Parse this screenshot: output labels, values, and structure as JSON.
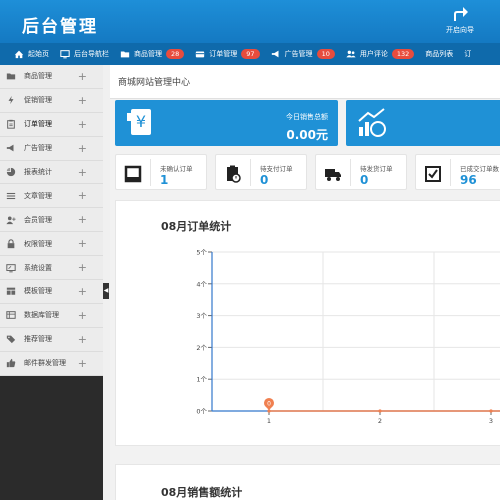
{
  "header": {
    "logo": "后台管理",
    "guide_label": "开启向导"
  },
  "nav": [
    {
      "label": "起始页",
      "icon": "home-icon",
      "badge": null
    },
    {
      "label": "后台导航栏",
      "icon": "monitor-icon",
      "badge": null
    },
    {
      "label": "商品管理",
      "icon": "folder-icon",
      "badge": "28"
    },
    {
      "label": "订单管理",
      "icon": "credit-card-icon",
      "badge": "97"
    },
    {
      "label": "广告管理",
      "icon": "megaphone-icon",
      "badge": "10"
    },
    {
      "label": "用户评论",
      "icon": "users-icon",
      "badge": "132"
    },
    {
      "label": "商品列表",
      "icon": null,
      "badge": null
    },
    {
      "label": "订",
      "icon": null,
      "badge": null
    }
  ],
  "sidebar": {
    "items": [
      {
        "label": "商品管理",
        "icon": "folder-icon"
      },
      {
        "label": "促销管理",
        "icon": "bolt-icon"
      },
      {
        "label": "订单管理",
        "icon": "clipboard-icon",
        "active": true
      },
      {
        "label": "广告管理",
        "icon": "megaphone-icon"
      },
      {
        "label": "报表统计",
        "icon": "pie-chart-icon"
      },
      {
        "label": "文章管理",
        "icon": "list-icon"
      },
      {
        "label": "会员管理",
        "icon": "user-plus-icon"
      },
      {
        "label": "权限管理",
        "icon": "lock-icon"
      },
      {
        "label": "系统设置",
        "icon": "desktop-icon"
      },
      {
        "label": "模板管理",
        "icon": "grid-icon"
      },
      {
        "label": "数据库管理",
        "icon": "database-icon"
      },
      {
        "label": "推荐管理",
        "icon": "tag-icon"
      },
      {
        "label": "邮件群发管理",
        "icon": "thumbs-up-icon"
      }
    ],
    "toggle": "◀"
  },
  "main": {
    "title": "商城网站管理中心",
    "sales_today_label": "今日销售总额",
    "sales_today_value": "0.00元",
    "order_stats": [
      {
        "label": "未确认订单",
        "value": "1",
        "icon": "square-icon"
      },
      {
        "label": "待支付订单",
        "value": "0",
        "icon": "clipboard-clock-icon"
      },
      {
        "label": "待发货订单",
        "value": "0",
        "icon": "truck-icon"
      },
      {
        "label": "已成交订单数",
        "value": "96",
        "icon": "check-list-icon"
      }
    ],
    "order_chart_title": "08月订单统计",
    "sales_chart_title": "08月销售额统计"
  },
  "colors": {
    "primary": "#1f91d6",
    "header": "#1479c2",
    "nav": "#0f6aab",
    "badge": "#e84c3d",
    "series": "#f08050"
  },
  "chart_data": {
    "type": "line",
    "title": "08月订单统计",
    "x": [
      1,
      2,
      3
    ],
    "series": [
      {
        "values": [
          0,
          0,
          0
        ]
      }
    ],
    "y_tick_labels": [
      "0个",
      "1个",
      "2个",
      "3个",
      "4个",
      "5个"
    ],
    "ylim": [
      0,
      5
    ],
    "data_labels": [
      "0"
    ],
    "grid": true
  }
}
